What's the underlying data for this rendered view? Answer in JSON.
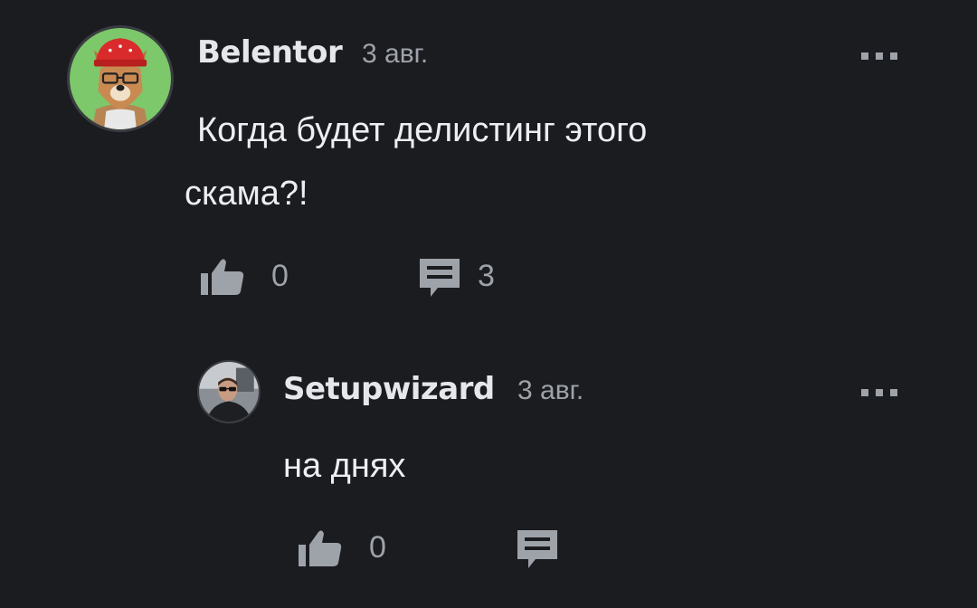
{
  "comments": [
    {
      "author": "Belentor",
      "date": "3 авг.",
      "text_line1": "Когда будет делистинг этого",
      "text_line2": "скама?!",
      "likes": "0",
      "replies": "3",
      "avatar_icon": "wolf-in-red-hat-avatar"
    },
    {
      "author": "Setupwizard",
      "date": "3 авг.",
      "text_line1": "на днях",
      "likes": "0",
      "avatar_icon": "man-with-sunglasses-avatar"
    }
  ],
  "colors": {
    "background": "#1b1c20",
    "text_primary": "#e9eaec",
    "text_secondary": "#9ea2a9",
    "icon": "#9ea2a9"
  }
}
